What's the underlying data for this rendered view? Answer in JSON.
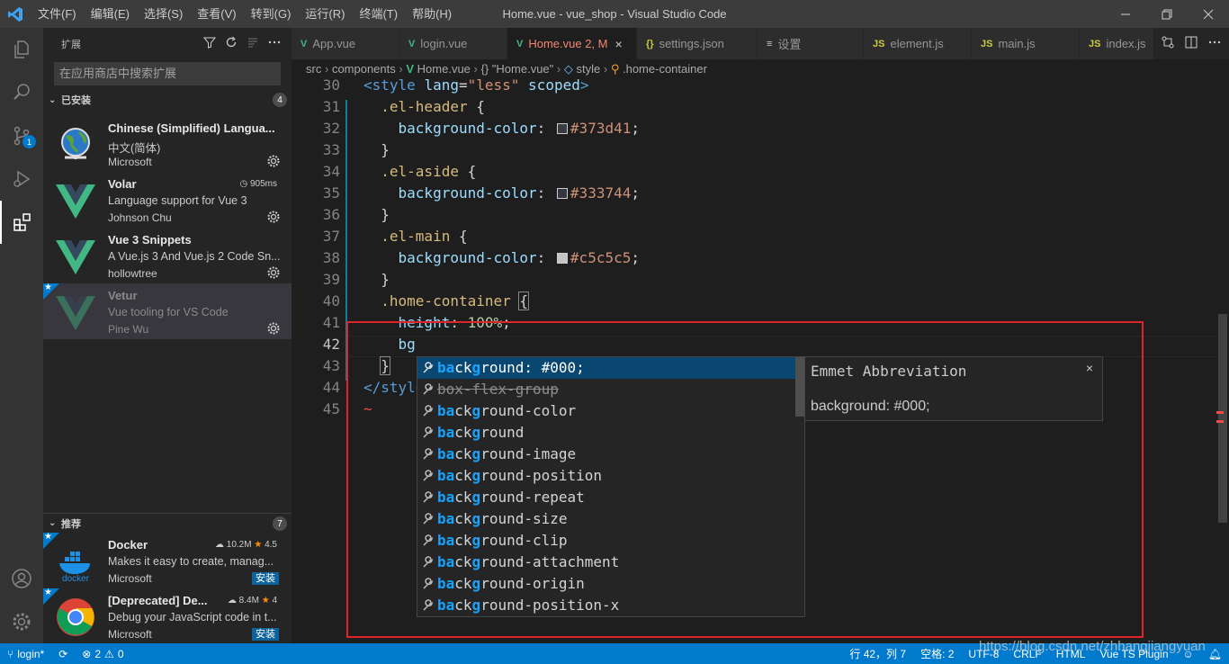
{
  "titlebar": {
    "title": "Home.vue - vue_shop - Visual Studio Code",
    "menu": [
      "文件(F)",
      "编辑(E)",
      "选择(S)",
      "查看(V)",
      "转到(G)",
      "运行(R)",
      "终端(T)",
      "帮助(H)"
    ]
  },
  "activity": {
    "items": [
      "explorer-icon",
      "search-icon",
      "source-control-icon",
      "run-debug-icon",
      "extensions-icon"
    ],
    "scm_badge": "1",
    "bottom": [
      "account-icon",
      "manage-gear-icon"
    ]
  },
  "sidebar": {
    "title": "扩展",
    "search_placeholder": "在应用商店中搜索扩展",
    "installed": {
      "label": "已安装",
      "count": "4",
      "items": [
        {
          "name": "Chinese (Simplified) Langua...",
          "desc": "中文(简体)",
          "publisher": "Microsoft",
          "meta": ""
        },
        {
          "name": "Volar",
          "desc": "Language support for Vue 3",
          "publisher": "Johnson Chu",
          "meta": "905ms"
        },
        {
          "name": "Vue 3 Snippets",
          "desc": "A Vue.js 3 And Vue.js 2 Code Sn...",
          "publisher": "hollowtree",
          "meta": ""
        },
        {
          "name": "Vetur",
          "desc": "Vue tooling for VS Code",
          "publisher": "Pine Wu",
          "meta": ""
        }
      ]
    },
    "recommended": {
      "label": "推荐",
      "count": "7",
      "items": [
        {
          "name": "Docker",
          "desc": "Makes it easy to create, manag...",
          "publisher": "Microsoft",
          "downloads": "10.2M",
          "rating": "4.5",
          "install": "安装"
        },
        {
          "name": "[Deprecated] De...",
          "desc": "Debug your JavaScript code in t...",
          "publisher": "Microsoft",
          "downloads": "8.4M",
          "rating": "4",
          "install": "安装"
        }
      ]
    }
  },
  "tabs": [
    {
      "label": "App.vue",
      "icon": "V",
      "active": false
    },
    {
      "label": "login.vue",
      "icon": "V",
      "active": false
    },
    {
      "label": "Home.vue 2, M",
      "icon": "V",
      "active": true
    },
    {
      "label": "settings.json",
      "icon": "{}",
      "active": false
    },
    {
      "label": "设置",
      "icon": "≡",
      "active": false
    },
    {
      "label": "element.js",
      "icon": "JS",
      "active": false
    },
    {
      "label": "main.js",
      "icon": "JS",
      "active": false
    },
    {
      "label": "index.js",
      "icon": "JS",
      "active": false
    }
  ],
  "breadcrumb": [
    "src",
    "components",
    "Home.vue",
    "{} \"Home.vue\"",
    "style",
    ".home-container"
  ],
  "editor": {
    "line_numbers": [
      "30",
      "31",
      "32",
      "33",
      "34",
      "35",
      "36",
      "37",
      "38",
      "39",
      "40",
      "41",
      "42",
      "43",
      "44",
      "45"
    ],
    "current_line": "42",
    "colors": {
      "header": "#373d41",
      "aside": "#333744",
      "main": "#c5c5c5"
    }
  },
  "suggest": {
    "query": "bg",
    "items": [
      {
        "pre": "ba",
        "mid": "c",
        "post": "k",
        "g": "g",
        "rest": "round: #000;"
      },
      {
        "text": "box-flex-group"
      },
      {
        "pre": "ba",
        "mid": "c",
        "post": "k",
        "g": "g",
        "rest": "round-color"
      },
      {
        "pre": "ba",
        "mid": "c",
        "post": "k",
        "g": "g",
        "rest": "round"
      },
      {
        "pre": "ba",
        "mid": "c",
        "post": "k",
        "g": "g",
        "rest": "round-image"
      },
      {
        "pre": "ba",
        "mid": "c",
        "post": "k",
        "g": "g",
        "rest": "round-position"
      },
      {
        "pre": "ba",
        "mid": "c",
        "post": "k",
        "g": "g",
        "rest": "round-repeat"
      },
      {
        "pre": "ba",
        "mid": "c",
        "post": "k",
        "g": "g",
        "rest": "round-size"
      },
      {
        "pre": "ba",
        "mid": "c",
        "post": "k",
        "g": "g",
        "rest": "round-clip"
      },
      {
        "pre": "ba",
        "mid": "c",
        "post": "k",
        "g": "g",
        "rest": "round-attachment"
      },
      {
        "pre": "ba",
        "mid": "c",
        "post": "k",
        "g": "g",
        "rest": "round-origin"
      },
      {
        "pre": "ba",
        "mid": "c",
        "post": "k",
        "g": "g",
        "rest": "round-position-x"
      }
    ],
    "details_title": "Emmet Abbreviation",
    "details_body": "background: #000;",
    "close": "×"
  },
  "status": {
    "branch": "login*",
    "problems": "2",
    "warnings": "0",
    "position": "行 42，列 7",
    "spaces": "空格: 2",
    "encoding": "UTF-8",
    "eol": "CRLF",
    "language": "HTML",
    "plugin": "Vue TS Plugin",
    "watermark": "https://blog.csdn.net/zhhangjiangyuan"
  },
  "accent": "#007acc"
}
